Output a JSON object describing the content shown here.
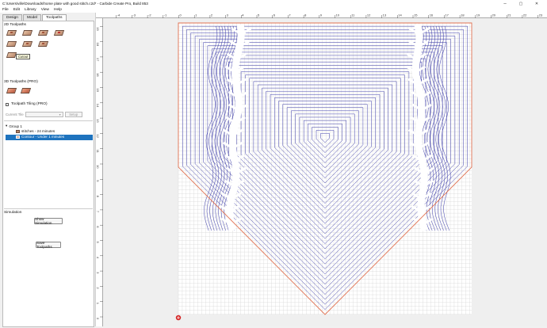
{
  "window": {
    "title": "C:\\Users\\ville\\Downloads\\home plate with good stitch.c2d* - Carbide Create Pro, Build 853",
    "minimize_glyph": "–",
    "maximize_glyph": "▢",
    "close_glyph": "✕"
  },
  "menu": [
    "File",
    "Edit",
    "Library",
    "View",
    "Help"
  ],
  "tabs": [
    "Design",
    "Model",
    "Toolpaths"
  ],
  "active_tab": "Toolpaths",
  "sections": {
    "toolpaths_2d": "2D Toolpaths",
    "toolpaths_3d": "3D Toolpaths (PRO)",
    "tiling": "Toolpath Tiling (PRO)",
    "simulation": "Simulation"
  },
  "tooltip": "Cutout",
  "tiling": {
    "current_tile_label": "Current Tile",
    "setup_label": "Setup",
    "checked": false
  },
  "tree": {
    "group": "Group 1",
    "group_toggle": "▾",
    "items": [
      "stitches - 24 minutes",
      "Contour - Under 1 minutes"
    ],
    "selected_index": 1
  },
  "buttons": {
    "show_simulation": "Show Simulation",
    "save_toolpaths": "Save Toolpaths"
  },
  "ruler": {
    "top_ticks": [
      "-4",
      "-3",
      "-2",
      "-1",
      "0",
      "1",
      "2",
      "3",
      "4",
      "5",
      "6",
      "7",
      "8",
      "9",
      "10",
      "11",
      "12",
      "13",
      "14",
      "15",
      "16",
      "17",
      "18",
      "19",
      "20",
      "21",
      "22",
      "23"
    ],
    "left_ticks": [
      "19",
      "18",
      "17",
      "16",
      "15",
      "14",
      "13",
      "12",
      "11",
      "10",
      "9",
      "8",
      "7",
      "6",
      "5",
      "4",
      "3",
      "2",
      "1",
      "0"
    ]
  },
  "colors": {
    "toolpath": "#3a3aa8",
    "outline": "#e07050",
    "grid": "#d8d8d8",
    "selection": "#1e73be",
    "origin_marker": "#d42020"
  },
  "icons": [
    "pocket-toolpath-icon",
    "contour-toolpath-icon",
    "drill-toolpath-icon",
    "vcarve-toolpath-icon",
    "advanced-vcarve-icon",
    "texture-toolpath-icon",
    "rough-3d-icon",
    "finish-3d-icon"
  ]
}
